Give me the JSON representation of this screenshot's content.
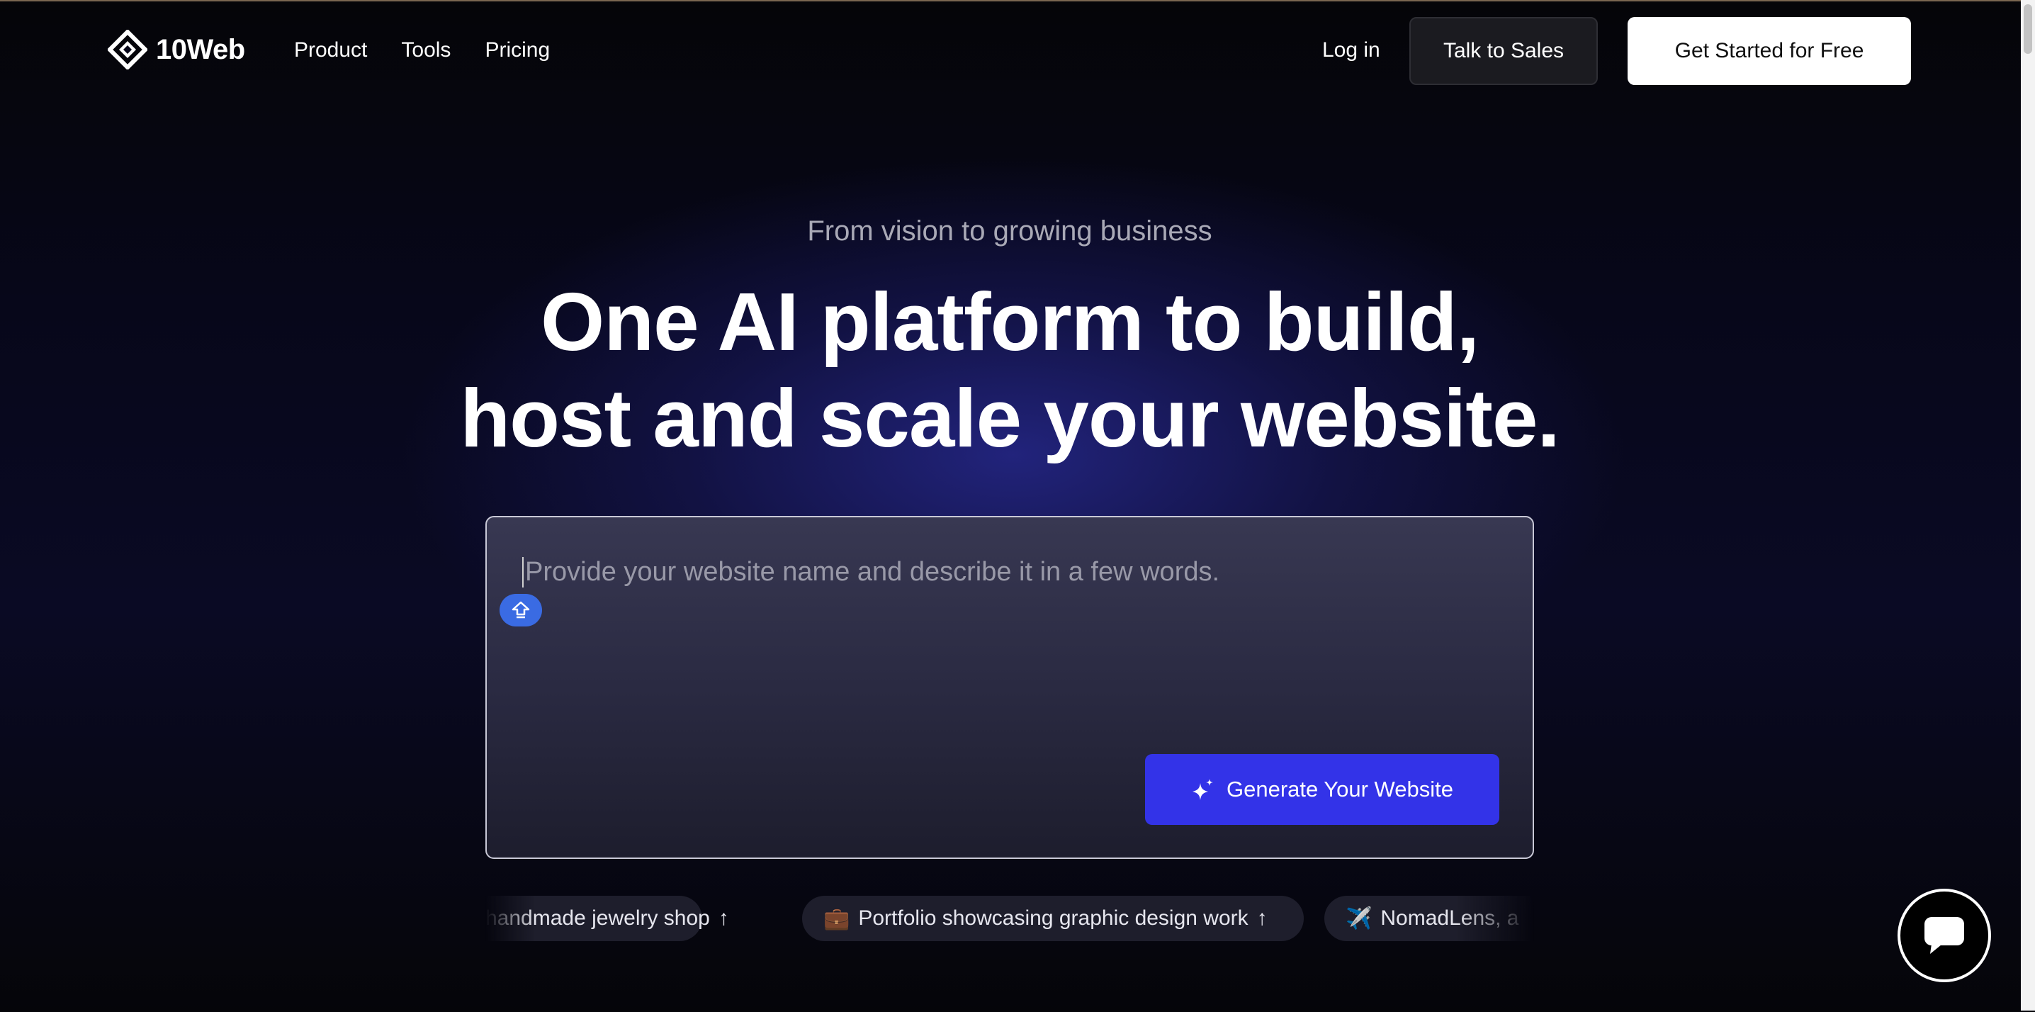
{
  "brand": {
    "name": "10Web",
    "logo_icon": "diamond-logo-icon"
  },
  "nav": {
    "items": [
      "Product",
      "Tools",
      "Pricing"
    ]
  },
  "header": {
    "login_label": "Log in",
    "sales_label": "Talk to Sales",
    "cta_label": "Get Started for Free"
  },
  "hero": {
    "eyebrow": "From vision to growing business",
    "headline_line1": "One AI platform to build,",
    "headline_line2": "host and scale your website."
  },
  "prompt": {
    "placeholder": "Provide your website name and describe it in a few words.",
    "generate_label": "Generate Your Website",
    "generate_icon": "sparkle-icon",
    "helper_icon": "grammar-assist-icon"
  },
  "suggestions": [
    {
      "emoji": "",
      "text": "handmade jewelry shop",
      "arrow": "↑"
    },
    {
      "emoji": "💼",
      "text": "Portfolio showcasing graphic design work",
      "arrow": "↑"
    },
    {
      "emoji": "✈️",
      "text": "NomadLens, a",
      "arrow": ""
    }
  ],
  "chat": {
    "icon": "chat-bubble-icon"
  },
  "colors": {
    "accent": "#3333e8",
    "background": "#07071a",
    "cta_background": "#ffffff"
  }
}
